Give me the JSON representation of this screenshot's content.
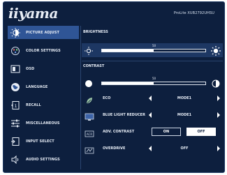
{
  "header": {
    "brand": "iiyama",
    "model": "ProLite XUB2792UHSU"
  },
  "sidebar": {
    "items": [
      {
        "label": "PICTURE ADJUST",
        "icon": "picture-adjust-icon",
        "active": true
      },
      {
        "label": "COLOR SETTINGS",
        "icon": "color-settings-icon",
        "active": false
      },
      {
        "label": "OSD",
        "icon": "osd-icon",
        "active": false
      },
      {
        "label": "LANGUAGE",
        "icon": "globe-icon",
        "active": false
      },
      {
        "label": "RECALL",
        "icon": "recall-icon",
        "active": false
      },
      {
        "label": "MISCELLANEOUS",
        "icon": "sliders-icon",
        "active": false
      },
      {
        "label": "INPUT SELECT",
        "icon": "input-select-icon",
        "active": false
      },
      {
        "label": "AUDIO SETTINGS",
        "icon": "speaker-icon",
        "active": false
      }
    ]
  },
  "brightness": {
    "title": "BRIGHTNESS",
    "value": 50,
    "value_text": "50",
    "max": 100,
    "left_icon": "dim-sun-icon",
    "right_icon": "bright-sun-icon"
  },
  "contrast": {
    "title": "CONTRAST",
    "value": 50,
    "value_text": "50",
    "max": 100,
    "left_icon": "contrast-low-icon",
    "right_icon": "contrast-high-icon"
  },
  "options": {
    "eco": {
      "label": "ECO",
      "value": "MODE1",
      "icon": "eco-icon"
    },
    "blue_light": {
      "label": "BLUE LIGHT REDUCER",
      "value": "MODE1",
      "icon": "blue-light-icon"
    },
    "adv_contrast": {
      "label": "ADV. CONTRAST",
      "on_label": "ON",
      "off_label": "OFF",
      "selected": "OFF",
      "icon": "adv-contrast-icon"
    },
    "overdrive": {
      "label": "OVERDRIVE",
      "value": "OFF",
      "icon": "overdrive-icon"
    }
  },
  "colors": {
    "background": "#0d1f3e",
    "active_item": "#2f5596",
    "text": "#e6ecf5"
  }
}
